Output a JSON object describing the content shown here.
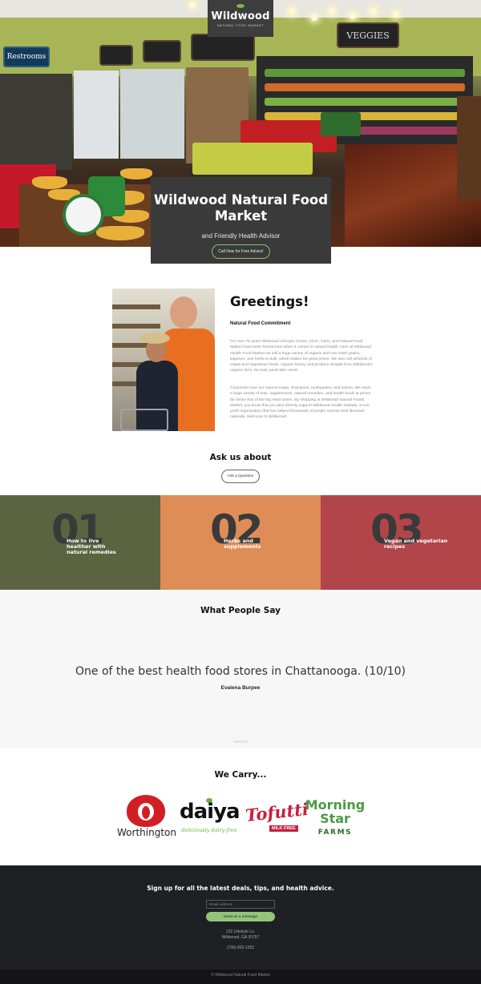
{
  "hero": {
    "logo": {
      "name": "Wildwood",
      "tagline": "NATURAL FOOD MARKET"
    },
    "store_signs": {
      "restrooms": "Restrooms",
      "veggies": "VEGGIES"
    },
    "title": "Wildwood Natural Food Market",
    "subtitle": "and Friendly Health Advisor",
    "cta_label": "Call Now for Free Advice!"
  },
  "greetings": {
    "title": "Greetings!",
    "subtitle": "Natural Food Commitment",
    "paragraphs": [
      "For over 75 years Wildwood Lifestyle Center, Clinic, Farm, and Natural Food Market have been forerunners when it comes to natural health. Here at Wildwood Health Food Market we sell a huge variety of organic and non-GMO grains, legumes, and herbs in bulk, which makes for great prices. We also sell all kinds of vegan and vegetarian foods, organic honey, and produce straight from Wildwood's organic farm. No toxic pesticides used!",
      "Customers love our natural soaps, shampoos, toothpastes, and lotions. We stock a large variety of teas, supplements, natural remedies, and health foods at prices far below that of the big retail stores. By shopping at Wildwood Natural Foods Market, you know that you also directly support Wildwood Health Institute, a non-profit organization that has helped thousands of people reverse their illnesses naturally. Welcome to Wildwood!"
    ]
  },
  "ask": {
    "title": "Ask us about",
    "button_label": "Ask a Question"
  },
  "topics": [
    {
      "number": "01",
      "label": "How to live healther with natural remedies",
      "color": "#5b6340"
    },
    {
      "number": "02",
      "label": "Herbs and supplements",
      "color": "#df8d56"
    },
    {
      "number": "03",
      "label": "Vegan and vegetarian recipes",
      "color": "#b1454a"
    }
  ],
  "testimonials": {
    "heading": "What People Say",
    "quote": "One of the best health food stores in Chattanooga. (10/10)",
    "author": "Evalena Burpee"
  },
  "brands": {
    "title": "We Carry...",
    "worthington": {
      "name": "Worthington"
    },
    "daiya": {
      "name": "daiya",
      "tagline": "deliciously dairy-free"
    },
    "tofutti": {
      "name": "Tofutti",
      "tagline": "MILK FREE"
    },
    "morningstar": {
      "name_line1": "Morning",
      "name_line2": "Star",
      "tagline": "FARMS"
    }
  },
  "footer": {
    "heading": "Sign up for all the latest deals, tips, and health advice.",
    "email_placeholder": "Email Address",
    "send_label": "Send us a message",
    "address_line1": "122 Lifestyle Ln.",
    "address_line2": "Wildwood, GA 30757",
    "phone": "(706) 820-1252",
    "copyright": "© Wildwood Natural Food Market"
  },
  "colors": {
    "accent_green": "#92c47a",
    "dark": "#1f2023",
    "hero_card": "#3a3a3a"
  }
}
